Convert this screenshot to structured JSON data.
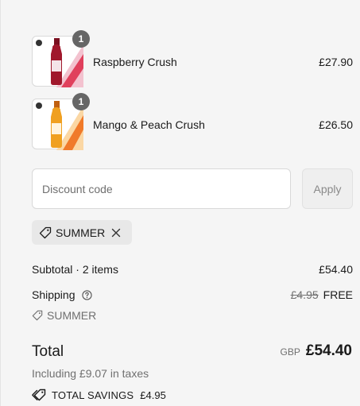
{
  "line_items": [
    {
      "name": "Raspberry Crush",
      "price": "£27.90",
      "quantity": "1",
      "image": "raspberry-bottle-image",
      "color": "#c0304a"
    },
    {
      "name": "Mango & Peach Crush",
      "price": "£26.50",
      "quantity": "1",
      "image": "mango-bottle-image",
      "color": "#f0a020"
    }
  ],
  "discount": {
    "placeholder": "Discount code",
    "apply_label": "Apply",
    "applied_code": "SUMMER"
  },
  "summary": {
    "subtotal_label": "Subtotal · 2 items",
    "subtotal_value": "£54.40",
    "shipping_label": "Shipping",
    "shipping_original": "£4.95",
    "shipping_value": "FREE",
    "shipping_discount_code": "SUMMER",
    "total_label": "Total",
    "currency": "GBP",
    "total_value": "£54.40",
    "taxes_text": "Including £9.07 in taxes",
    "savings_label": "TOTAL SAVINGS",
    "savings_value": "£4.95"
  },
  "colors": {
    "background": "#f5f5f5",
    "muted_text": "#707070",
    "badge": "#666666"
  }
}
